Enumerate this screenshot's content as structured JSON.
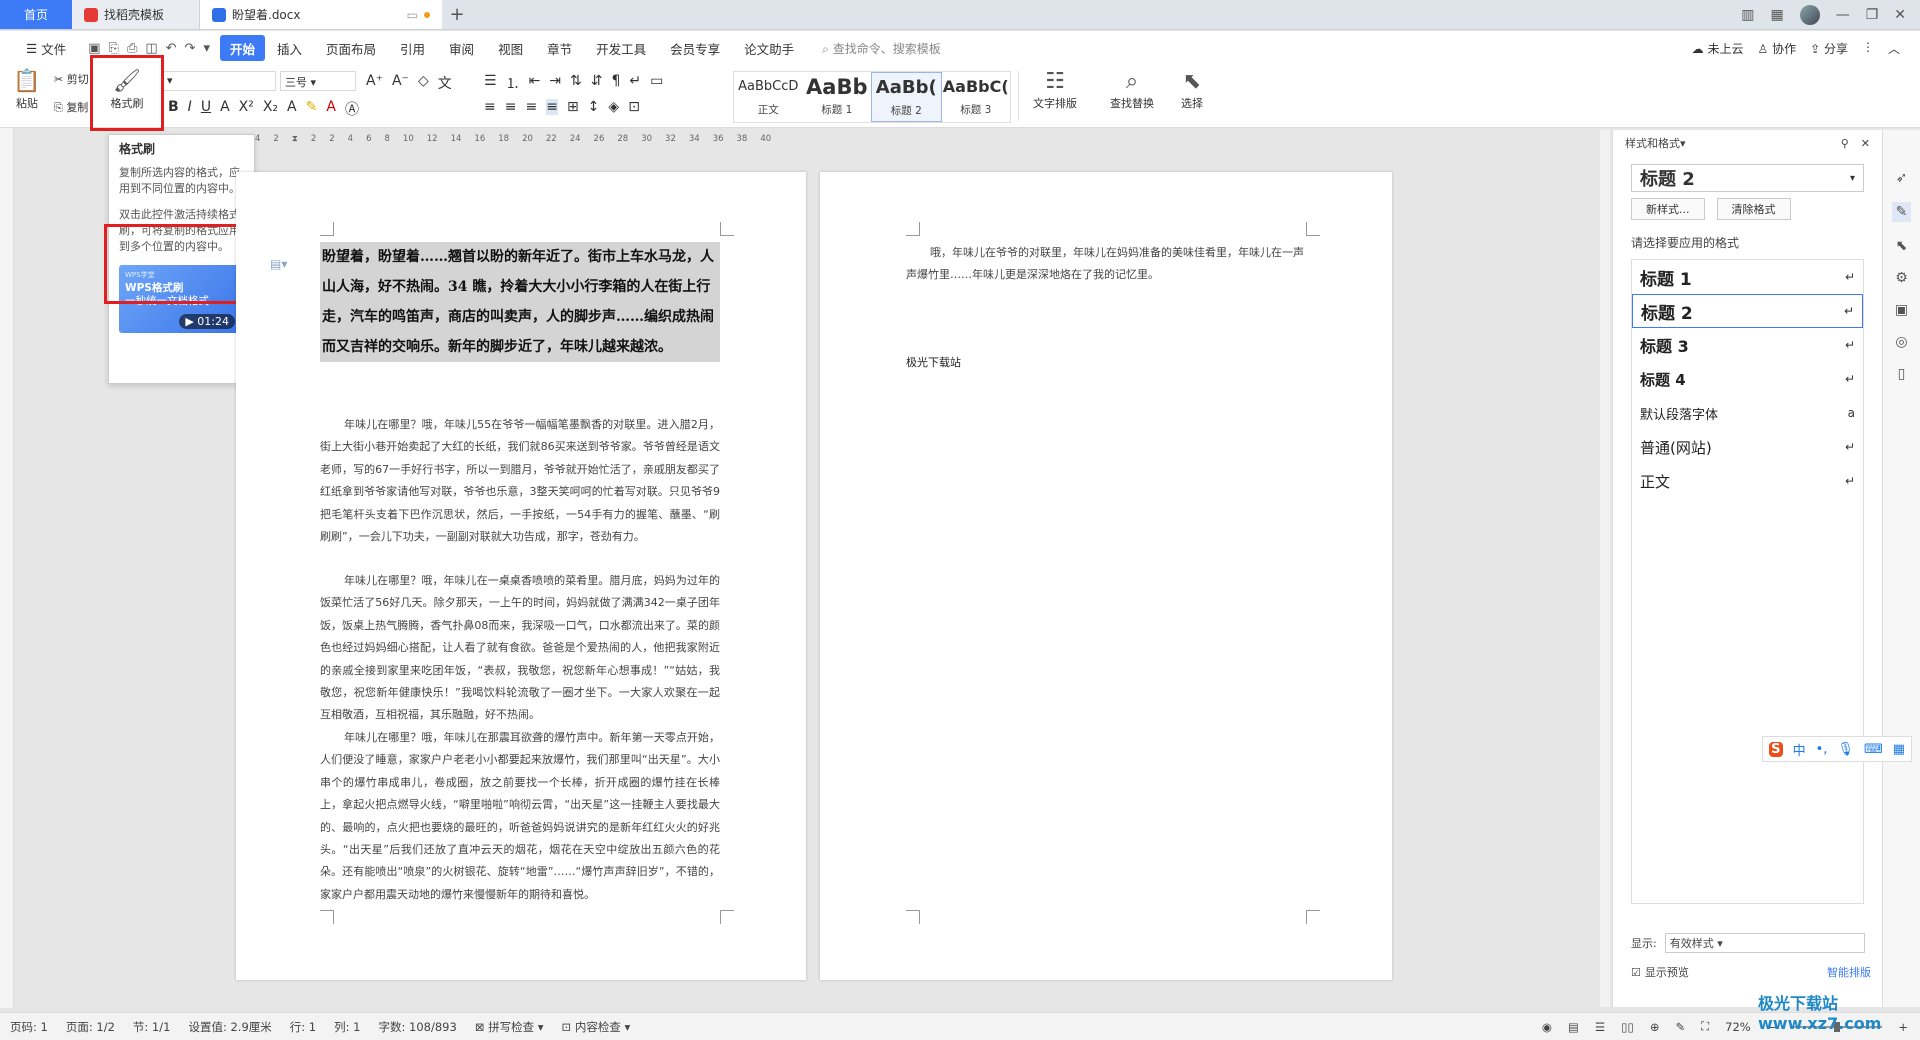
{
  "tabs": {
    "home": "首页",
    "template": "找稻壳模板",
    "doc": "盼望着.docx"
  },
  "menu": {
    "file": "文件",
    "items": [
      "开始",
      "插入",
      "页面布局",
      "引用",
      "审阅",
      "视图",
      "章节",
      "开发工具",
      "会员专享",
      "论文助手"
    ],
    "search": "查找命令、搜索模板",
    "cloud": "未上云",
    "collab": "协作",
    "share": "分享"
  },
  "ribbon": {
    "paste": "粘贴",
    "cut": "剪切",
    "copy": "复制",
    "format_painter": "格式刷",
    "font_size": "三号",
    "styles": [
      {
        "preview": "AaBbCcD",
        "caption": "正文"
      },
      {
        "preview": "AaBb",
        "caption": "标题 1"
      },
      {
        "preview": "AaBb(",
        "caption": "标题 2"
      },
      {
        "preview": "AaBbC(",
        "caption": "标题 3"
      }
    ],
    "text_layout": "文字排版",
    "find_replace": "查找替换",
    "select": "选择"
  },
  "tooltip": {
    "title": "格式刷",
    "desc1": "复制所选内容的格式，应用到不同位置的内容中。",
    "desc2": "双击此控件激活持续格式刷，可将复制的格式应用到多个位置的内容中。",
    "video_tag": "WPS学堂",
    "video_title": "WPS格式刷",
    "video_subtitle": "一秒统一文档格式",
    "video_duration": "01:24"
  },
  "ruler_numbers": [
    "4",
    "2",
    "2",
    "2",
    "4",
    "6",
    "8",
    "10",
    "12",
    "14",
    "16",
    "18",
    "20",
    "22",
    "24",
    "26",
    "28",
    "30",
    "32",
    "34",
    "36",
    "38",
    "40"
  ],
  "page1": {
    "heading": "盼望着，盼望着……翘首以盼的新年近了。街市上车水马龙，人山人海，好不热闹。34 瞧，拎着大大小小行李箱的人在街上行走，汽车的鸣笛声，商店的叫卖声，人的脚步声……编织成热闹而又吉祥的交响乐。新年的脚步近了，年味儿越来越浓。",
    "paragraphs": [
      "年味儿在哪里？哦，年味儿55在爷爷一幅幅笔墨飘香的对联里。进入腊2月，街上大街小巷开始卖起了大红的长纸，我们就86买来送到爷爷家。爷爷曾经是语文老师，写的67一手好行书字，所以一到腊月，爷爷就开始忙活了，亲戚朋友都买了红纸拿到爷爷家请他写对联，爷爷也乐意，3整天笑呵呵的忙着写对联。只见爷爷9把毛笔杆头支着下巴作沉思状，然后，一手按纸，一54手有力的握笔、蘸墨、“刷刷刷”，一会儿下功夫，一副副对联就大功告成，那字，苍劲有力。",
      "年味儿在哪里？哦，年味儿在一桌桌香喷喷的菜肴里。腊月底，妈妈为过年的饭菜忙活了56好几天。除夕那天，一上午的时间，妈妈就做了满满342一桌子团年饭，饭桌上热气腾腾，香气扑鼻08而来，我深吸一口气，口水都流出来了。菜的颜色也经过妈妈细心搭配，让人看了就有食欲。爸爸是个爱热闹的人，他把我家附近的亲戚全接到家里来吃团年饭，“表叔，我敬您，祝您新年心想事成！”“姑姑，我敬您，祝您新年健康快乐！”我喝饮料轮流敬了一圈才坐下。一大家人欢聚在一起互相敬酒，互相祝福，其乐融融，好不热闹。",
      "年味儿在哪里？哦，年味儿在那震耳欲聋的爆竹声中。新年第一天零点开始，人们便没了睡意，家家户户老老小小都要起来放爆竹，我们那里叫“出天星”。大小串个的爆竹串成串儿，卷成圈，放之前要找一个长棒，折开成圈的爆竹挂在长棒上，拿起火把点燃导火线，“噼里啪啦”响彻云霄，“出天星”这一挂鞭主人要找最大的、最响的，点火把也要烧的最旺的，听爸爸妈妈说讲究的是新年红红火火的好兆头。“出天星”后我们还放了直冲云天的烟花，烟花在天空中绽放出五颜六色的花朵。还有能喷出“喷泉”的火树银花、旋转“地雷”……“爆竹声声辞旧岁”，不错的，家家户户都用震天动地的爆竹来慢慢新年的期待和喜悦。"
    ]
  },
  "page2": {
    "text": "哦，年味儿在爷爷的对联里，年味儿在妈妈准备的美味佳肴里，年味儿在一声声爆竹里……年味儿更是深深地烙在了我的记忆里。",
    "signature": "极光下载站"
  },
  "right_panel": {
    "title": "样式和格式",
    "current_style": "标题 2",
    "new_style": "新样式...",
    "clear_format": "清除格式",
    "apply_label": "请选择要应用的格式",
    "styles": [
      "标题 1",
      "标题 2",
      "标题 3",
      "标题 4",
      "默认段落字体",
      "普通(网站)",
      "正文"
    ],
    "show_label": "显示:",
    "show_value": "有效样式",
    "preview_label": "显示预览",
    "smart_layout": "智能排版"
  },
  "ime": {
    "lang": "中"
  },
  "status": {
    "page_num": "页码: 1",
    "pages": "页面: 1/2",
    "section": "节: 1/1",
    "setting": "设置值: 2.9厘米",
    "row": "行: 1",
    "col": "列: 1",
    "words": "字数: 108/893",
    "spell": "拼写检查",
    "content": "内容检查",
    "zoom": "72%"
  },
  "watermark": "极光下载站 www.xz7.com",
  "colors": {
    "accent": "#3c7bf5",
    "highlight": "#e02020"
  }
}
